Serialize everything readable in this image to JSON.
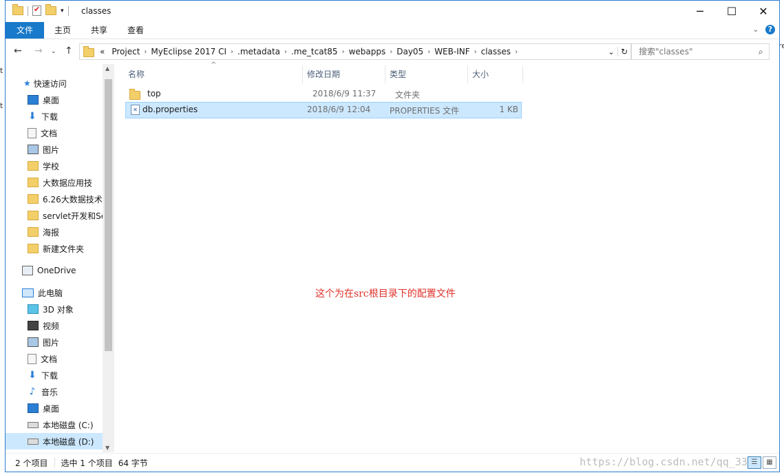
{
  "window": {
    "title": "classes"
  },
  "ribbon": {
    "tabs": [
      "文件",
      "主页",
      "共享",
      "查看"
    ]
  },
  "address": {
    "prefix": "«",
    "crumbs": [
      "Project",
      "MyEclipse 2017 CI",
      ".metadata",
      ".me_tcat85",
      "webapps",
      "Day05",
      "WEB-INF",
      "classes"
    ]
  },
  "search": {
    "placeholder": "搜索\"classes\""
  },
  "nav": {
    "quick_access": "快速访问",
    "quick_items": [
      {
        "label": "桌面",
        "icon": "desktop-icon",
        "pinned": true
      },
      {
        "label": "下载",
        "icon": "download-icon",
        "pinned": true
      },
      {
        "label": "文档",
        "icon": "document-icon",
        "pinned": true
      },
      {
        "label": "图片",
        "icon": "picture-icon",
        "pinned": true
      },
      {
        "label": "学校",
        "icon": "folder-icon",
        "pinned": true
      },
      {
        "label": "大数据应用技",
        "icon": "folder-icon",
        "pinned": true
      },
      {
        "label": "6.26大数据技术-",
        "icon": "folder-icon",
        "pinned": false
      },
      {
        "label": "servlet开发和Se",
        "icon": "folder-icon",
        "pinned": false
      },
      {
        "label": "海报",
        "icon": "folder-icon",
        "pinned": false
      },
      {
        "label": "新建文件夹",
        "icon": "folder-icon",
        "pinned": false
      }
    ],
    "onedrive": "OneDrive",
    "this_pc": "此电脑",
    "pc_items": [
      {
        "label": "3D 对象",
        "icon": "3d-objects-icon"
      },
      {
        "label": "视频",
        "icon": "video-icon"
      },
      {
        "label": "图片",
        "icon": "picture-icon"
      },
      {
        "label": "文档",
        "icon": "document-icon"
      },
      {
        "label": "下载",
        "icon": "download-icon"
      },
      {
        "label": "音乐",
        "icon": "music-icon"
      },
      {
        "label": "桌面",
        "icon": "desktop-icon"
      },
      {
        "label": "本地磁盘 (C:)",
        "icon": "drive-icon"
      },
      {
        "label": "本地磁盘 (D:)",
        "icon": "drive-icon"
      }
    ]
  },
  "columns": [
    "名称",
    "修改日期",
    "类型",
    "大小"
  ],
  "files": [
    {
      "name": "top",
      "modified": "2018/6/9 11:37",
      "type": "文件夹",
      "size": "",
      "icon": "folder-icon"
    },
    {
      "name": "db.properties",
      "modified": "2018/6/9 12:04",
      "type": "PROPERTIES 文件",
      "size": "1 KB",
      "icon": "properties-file-icon"
    }
  ],
  "annotation": "这个为在src根目录下的配置文件",
  "status": {
    "count": "2 个项目",
    "selected": "选中 1 个项目",
    "size": "64 字节"
  },
  "watermark": "https://blog.csdn.net/qq_3359",
  "outside_text": [
    "t",
    "t",
    "re"
  ]
}
